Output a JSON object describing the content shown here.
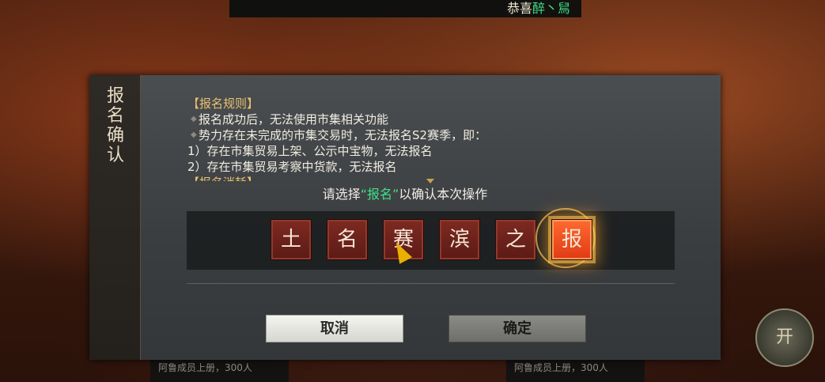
{
  "banner": {
    "prefix": "恭喜",
    "name": "醉丶舃"
  },
  "background": {
    "strip_text_1": "阿鲁成员上册，300人",
    "strip_text_2": "阿鲁成员上册，300人",
    "corner_button": "开"
  },
  "dialog": {
    "side_title": "报名确认",
    "rules": {
      "heading": "【报名规则】",
      "bullet_1": "报名成功后，无法使用市集相关功能",
      "bullet_2": "势力存在未完成的市集交易时，无法报名S2赛季，即：",
      "item_1": "1）存在市集贸易上架、公示中宝物，无法报名",
      "item_2": "2）存在市集贸易考察中货款，无法报名",
      "next_heading_partial": "【报名消耗】"
    },
    "prompt": {
      "before": "请选择",
      "highlight": "“报名”",
      "after": "以确认本次操作"
    },
    "characters": [
      "土",
      "名",
      "赛",
      "滨",
      "之",
      "报"
    ],
    "active_character_index": 5,
    "cancel_label": "取消",
    "confirm_label": "确定"
  },
  "colors": {
    "highlight_green": "#3fe08a",
    "active_char": "#e03a14",
    "char_red": "#6e221b",
    "heading_gold": "#e8c070"
  }
}
